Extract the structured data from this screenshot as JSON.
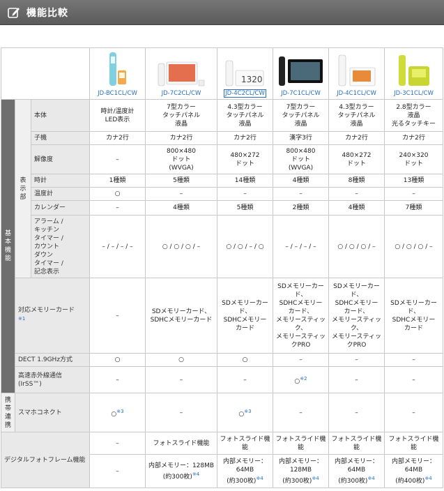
{
  "header": {
    "title": "機能比較",
    "icon": "edit-icon"
  },
  "products": [
    {
      "name": "JD-BC1CL/CW",
      "selected": false
    },
    {
      "name": "JD-7C2CL/CW",
      "selected": false
    },
    {
      "name": "JD-4C2CL/CW",
      "selected": true
    },
    {
      "name": "JD-7C1CL/CW",
      "selected": false
    },
    {
      "name": "JD-4C1CL/CW",
      "selected": false
    },
    {
      "name": "JD-3C1CL/CW",
      "selected": false
    }
  ],
  "categories": {
    "basic": "基本機能",
    "display": "表示部",
    "mobile": "携帯連携"
  },
  "rows": {
    "body": {
      "label": "本体",
      "values": [
        "時計/温度計\nLED表示",
        "7型カラー\nタッチパネル\n液晶",
        "4.3型カラー\nタッチパネル\n液晶",
        "7型カラー\nタッチパネル\n液晶",
        "4.3型カラー\nタッチパネル\n液晶",
        "2.8型カラー\n液晶\n光るタッチキー"
      ]
    },
    "handset": {
      "label": "子機",
      "values": [
        "カナ2行",
        "カナ2行",
        "カナ2行",
        "漢字3行",
        "カナ2行",
        "カナ2行"
      ]
    },
    "resolution": {
      "label": "解像度",
      "values": [
        "–",
        "800×480\nドット\n(WVGA)",
        "480×272\nドット",
        "800×480\nドット\n(WVGA)",
        "480×272\nドット",
        "240×320\nドット"
      ]
    },
    "clock": {
      "label": "時計",
      "values": [
        "1種類",
        "5種類",
        "14種類",
        "4種類",
        "8種類",
        "13種類"
      ]
    },
    "thermo": {
      "label": "温度計",
      "values": [
        "○",
        "–",
        "–",
        "–",
        "–",
        "–"
      ]
    },
    "calendar": {
      "label": "カレンダー",
      "values": [
        "–",
        "4種類",
        "5種類",
        "2種類",
        "4種類",
        "7種類"
      ]
    },
    "alarm": {
      "label": "アラーム /\nキッチン\nタイマー /\nカウント\nダウン\nタイマー /\n記念表示",
      "values": [
        "– / – / – / –",
        "○ / ○ / ○ / –",
        "○ / ○ / – / ○",
        "– / – / – / –",
        "○ / ○ / ○ / –",
        "○ / ○ / ○ / –"
      ]
    },
    "memcard": {
      "label": "対応メモリーカード",
      "note": "※1",
      "values": [
        "–",
        "SDメモリーカード、\nSDHCメモリーカード",
        "SDメモリーカー\nド、\nSDHCメモリー\nカード",
        "SDメモリーカー\nド、\nSDHCメモリー\nカード、\nメモリースティッ\nク、\nメモリースティッ\nクPRO",
        "SDメモリーカー\nド、\nSDHCメモリー\nカード、\nメモリースティッ\nク、\nメモリースティッ\nクPRO",
        "SDメモリーカー\nド、\nSDHCメモリー\nカード"
      ]
    },
    "dect": {
      "label": "DECT 1.9GHz方式",
      "values": [
        "○",
        "○",
        "○",
        "–",
        "–",
        "–"
      ]
    },
    "irss": {
      "label": "高速赤外線通信\n(IrSS™)",
      "values": [
        "–",
        "–",
        "–",
        "○",
        "–",
        "–"
      ],
      "notes": [
        "",
        "",
        "",
        "※2",
        "",
        ""
      ]
    },
    "smartphone": {
      "label": "スマホコネクト",
      "values": [
        "○",
        "–",
        "○",
        "–",
        "–",
        "–"
      ],
      "notes": [
        "※3",
        "",
        "※3",
        "",
        "",
        ""
      ]
    },
    "photoframe": {
      "label": "デジタルフォトフレーム機能",
      "slideshow": [
        "–",
        "フォトスライド機能",
        "フォトスライド機\n能",
        "フォトスライド機\n能",
        "フォトスライド機\n能",
        "フォトスライド機能"
      ],
      "memory": [
        "–",
        "内部メモリー：128MB\n(約300枚)",
        "内部メモリー：\n64MB\n(約300枚)",
        "内部メモリー：\n128MB\n(約300枚)",
        "内部メモリー：\n64MB\n(約300枚)",
        "内部メモリー：\n64MB\n(約400枚)"
      ],
      "memory_note": "※4"
    }
  }
}
